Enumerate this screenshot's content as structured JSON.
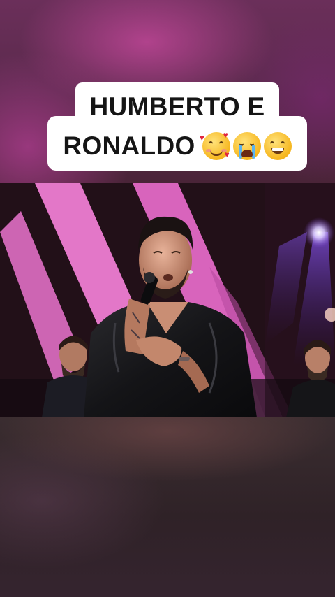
{
  "caption": {
    "line1": "HUMBERTO E",
    "line2": "RONALDO"
  },
  "emojis": [
    "smiling-face-with-hearts-icon",
    "loudly-crying-face-icon",
    "beaming-face-with-smiling-eyes-icon"
  ],
  "colors": {
    "stage_pink": "#e06fc4",
    "stage_purple": "#6a36c8",
    "caption_background": "#ffffff",
    "caption_text": "#151515"
  }
}
